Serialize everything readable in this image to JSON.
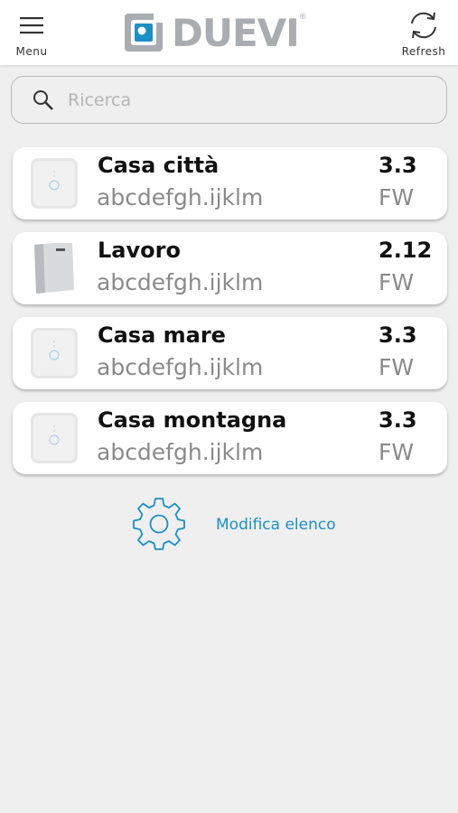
{
  "header": {
    "menu_label": "Menu",
    "refresh_label": "Refresh",
    "logo_text": "DUEVI",
    "logo_mark": "®"
  },
  "search": {
    "placeholder": "Ricerca",
    "value": ""
  },
  "devices": [
    {
      "name": "Casa città",
      "address": "abcdefgh.ijklm",
      "version": "3.3",
      "fw_label": "FW",
      "thumb": "white-device-icon"
    },
    {
      "name": "Lavoro",
      "address": "abcdefgh.ijklm",
      "version": "2.12",
      "fw_label": "FW",
      "thumb": "grey-panel-device-icon"
    },
    {
      "name": "Casa mare",
      "address": "abcdefgh.ijklm",
      "version": "3.3",
      "fw_label": "FW",
      "thumb": "white-device-icon"
    },
    {
      "name": "Casa montagna",
      "address": "abcdefgh.ijklm",
      "version": "3.3",
      "fw_label": "FW",
      "thumb": "white-device-icon"
    }
  ],
  "edit_list": {
    "label": "Modifica elenco",
    "icon": "gear-icon"
  },
  "colors": {
    "accent": "#1c8fc6",
    "logo_grey": "#a9adb1",
    "background": "#efefef"
  }
}
